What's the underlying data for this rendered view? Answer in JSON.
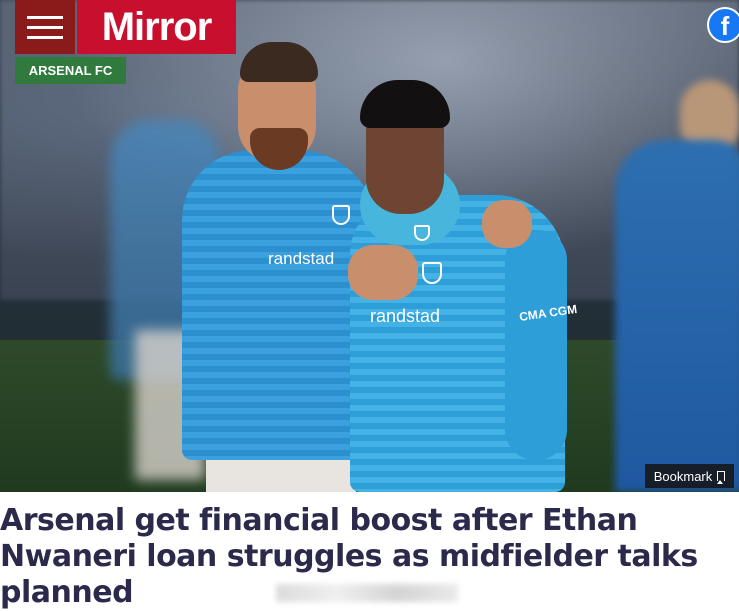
{
  "header": {
    "menu_icon": "hamburger-menu-icon",
    "logo_text": "Mirror",
    "section_label": "ARSENAL FC",
    "facebook_icon": "facebook-icon",
    "colors": {
      "menu_bg": "#8b1a1a",
      "logo_bg": "#c8102e",
      "section_bg": "#2f7a3c",
      "facebook": "#1877f2"
    }
  },
  "hero": {
    "kit_text": {
      "sponsor_left": "randstad",
      "sponsor_right": "randstad",
      "sleeve_sponsor": "CMA CGM"
    },
    "bookmark": {
      "label": "Bookmark",
      "icon": "bookmark-icon"
    }
  },
  "article": {
    "headline": "Arsenal get financial boost after Ethan Nwaneri loan struggles as midfielder talks planned",
    "headline_color": "#2b2a4a"
  }
}
